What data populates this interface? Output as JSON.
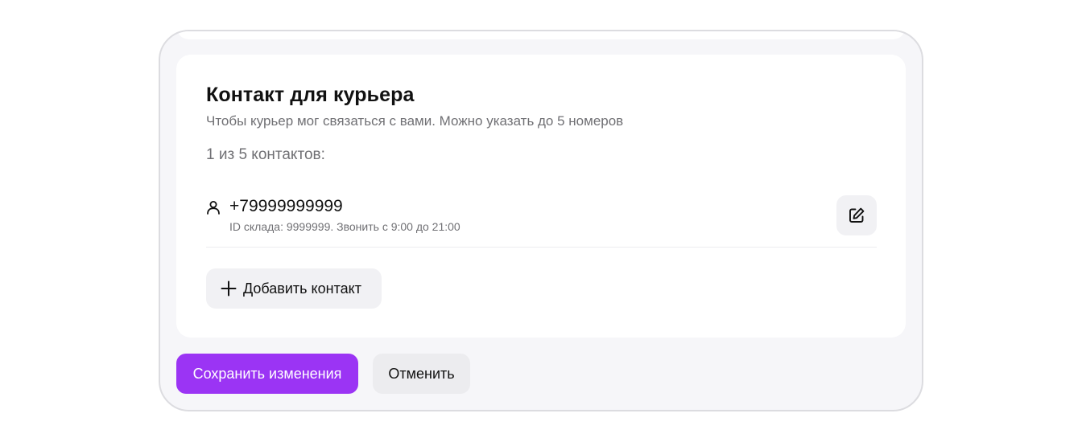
{
  "card": {
    "title": "Контакт для курьера",
    "subtitle": "Чтобы курьер мог связаться с вами. Можно указать до 5 номеров",
    "count_label": "1 из 5 контактов:"
  },
  "contacts": [
    {
      "phone": "+79999999999",
      "details": "ID склада: 9999999. Звонить с 9:00 до 21:00",
      "icon": "person-icon",
      "action_icon": "edit-icon"
    }
  ],
  "add_contact": {
    "label": "Добавить контакт",
    "icon": "plus-icon"
  },
  "footer": {
    "save_label": "Сохранить изменения",
    "cancel_label": "Отменить"
  },
  "colors": {
    "accent": "#9b34f4",
    "panel_background": "#f6f6f9",
    "secondary_button": "#f1f1f4",
    "muted_text": "#707074"
  }
}
